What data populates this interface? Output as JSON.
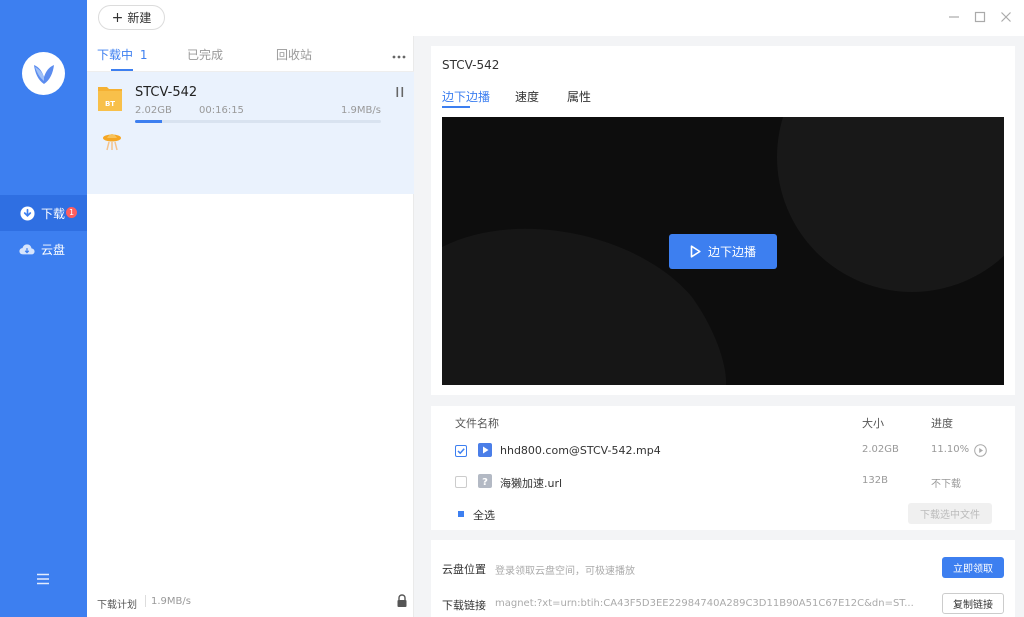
{
  "sidebar": {
    "items": [
      {
        "label": "下载",
        "badge": "1",
        "icon": "download-icon"
      },
      {
        "label": "云盘",
        "icon": "cloud-icon"
      }
    ],
    "menu_icon": "menu-icon"
  },
  "topbar": {
    "new_label": "新建",
    "window_controls": [
      "minimize-icon",
      "maximize-icon",
      "close-icon"
    ]
  },
  "list": {
    "tabs": [
      {
        "label": "下载中",
        "count": "1"
      },
      {
        "label": "已完成"
      },
      {
        "label": "回收站"
      }
    ],
    "tasks": [
      {
        "name": "STCV-542",
        "size": "2.02GB",
        "time": "00:16:15",
        "speed": "1.9MB/s",
        "progress": 0.11,
        "file_badge": "BT"
      }
    ],
    "footer": {
      "plan_label": "下载计划",
      "plan_speed": "1.9MB/s"
    }
  },
  "detail": {
    "title": "STCV-542",
    "tabs": [
      "边下边播",
      "速度",
      "属性"
    ],
    "play_label": "边下边播"
  },
  "files": {
    "headers": {
      "name": "文件名称",
      "size": "大小",
      "progress": "进度"
    },
    "rows": [
      {
        "name": "hhd800.com@STCV-542.mp4",
        "size": "2.02GB",
        "progress": "11.10%",
        "checked": true,
        "type": "video"
      },
      {
        "name": "海獭加速.url",
        "size": "132B",
        "progress": "不下载",
        "checked": false,
        "type": "unknown"
      }
    ],
    "select_all_label": "全选",
    "download_selected_label": "下载选中文件"
  },
  "cloud": {
    "location_label": "云盘位置",
    "location_text": "登录领取云盘空间，可极速播放",
    "claim_button": "立即领取",
    "link_label": "下载链接",
    "link_text": "magnet:?xt=urn:btih:CA43F5D3EE22984740A289C3D11B90A51C67E12C&dn=ST...",
    "copy_button": "复制链接"
  },
  "colors": {
    "accent": "#3d7ff0",
    "sidebar": "#3d7ff0",
    "badge": "#ff5e5e"
  }
}
